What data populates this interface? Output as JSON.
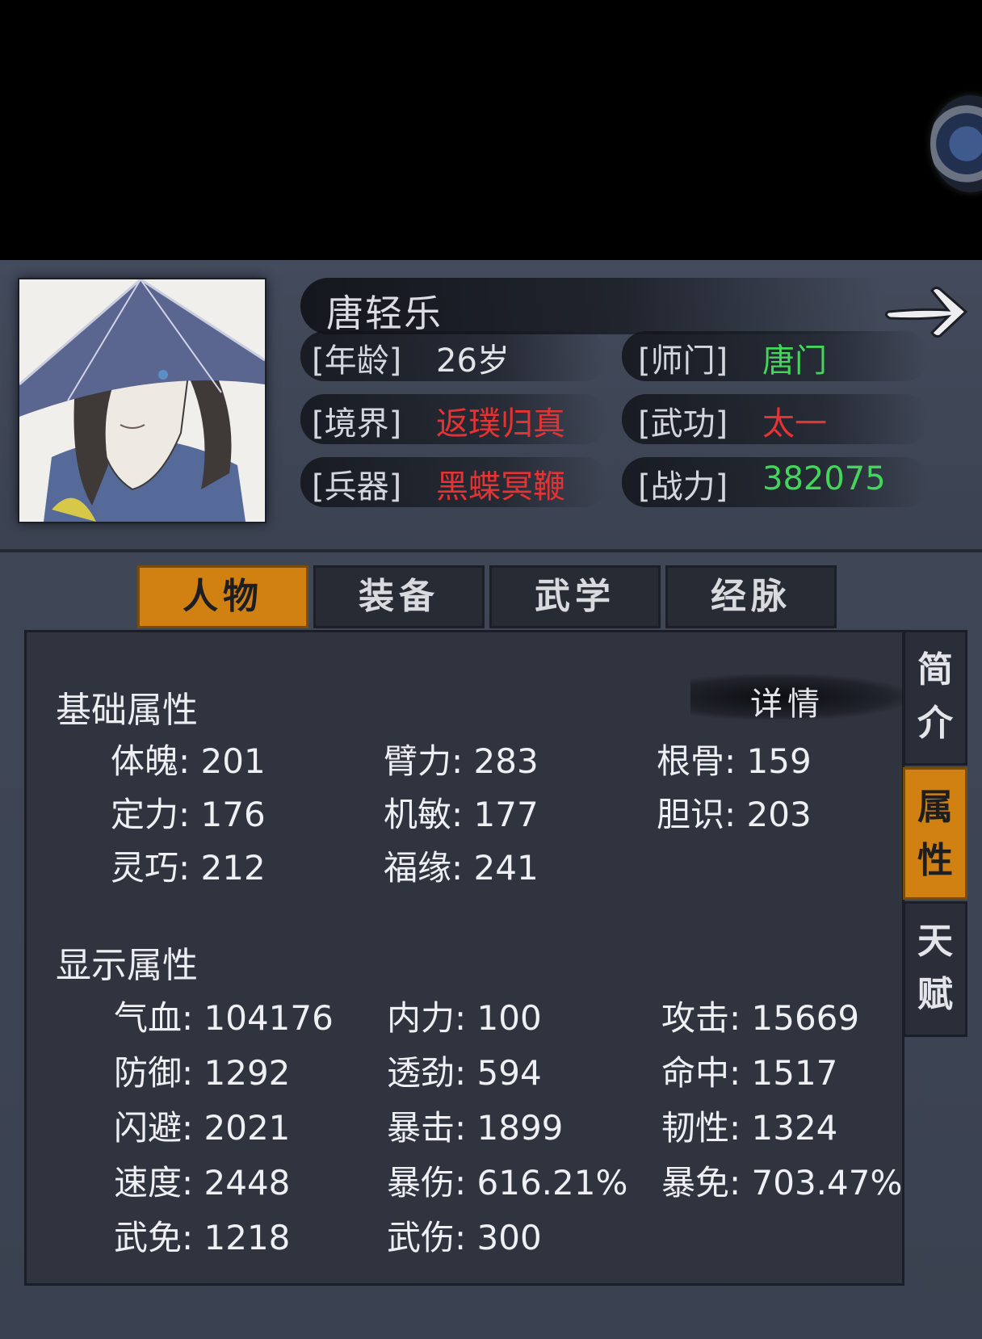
{
  "character": {
    "name": "唐轻乐",
    "age_label": "[年龄]",
    "age_value": "26岁",
    "sect_label": "[师门]",
    "sect_value": "唐门",
    "realm_label": "[境界]",
    "realm_value": "返璞归真",
    "kungfu_label": "[武功]",
    "kungfu_value": "太一",
    "weapon_label": "[兵器]",
    "weapon_value": "黑蝶冥鞭",
    "power_label": "[战力]",
    "power_value": "382075"
  },
  "tabs": [
    {
      "label": "人物",
      "active": true
    },
    {
      "label": "装备",
      "active": false
    },
    {
      "label": "武学",
      "active": false
    },
    {
      "label": "经脉",
      "active": false
    }
  ],
  "side_tabs": [
    {
      "chars": [
        "简",
        "介"
      ],
      "active": false
    },
    {
      "chars": [
        "属",
        "性"
      ],
      "active": true
    },
    {
      "chars": [
        "天",
        "赋"
      ],
      "active": false
    }
  ],
  "basic": {
    "title": "基础属性",
    "detail_button": "详情",
    "stats": [
      "体魄: 201",
      "臂力: 283",
      "根骨: 159",
      "定力: 176",
      "机敏: 177",
      "胆识: 203",
      "灵巧: 212",
      "福缘: 241"
    ]
  },
  "display": {
    "title": "显示属性",
    "stats": [
      "气血: 104176",
      "内力: 100",
      "攻击: 15669",
      "防御: 1292",
      "透劲: 594",
      "命中: 1517",
      "闪避: 2021",
      "暴击: 1899",
      "韧性: 1324",
      "速度: 2448",
      "暴伤: 616.21%",
      "暴免: 703.47%",
      "武免: 1218",
      "武伤: 300"
    ]
  },
  "colors": {
    "accent": "#d08111",
    "red": "#e53232",
    "green": "#42d65a"
  },
  "icons": {
    "next": "arrow-right-icon",
    "menu": "menu-knob-icon"
  }
}
